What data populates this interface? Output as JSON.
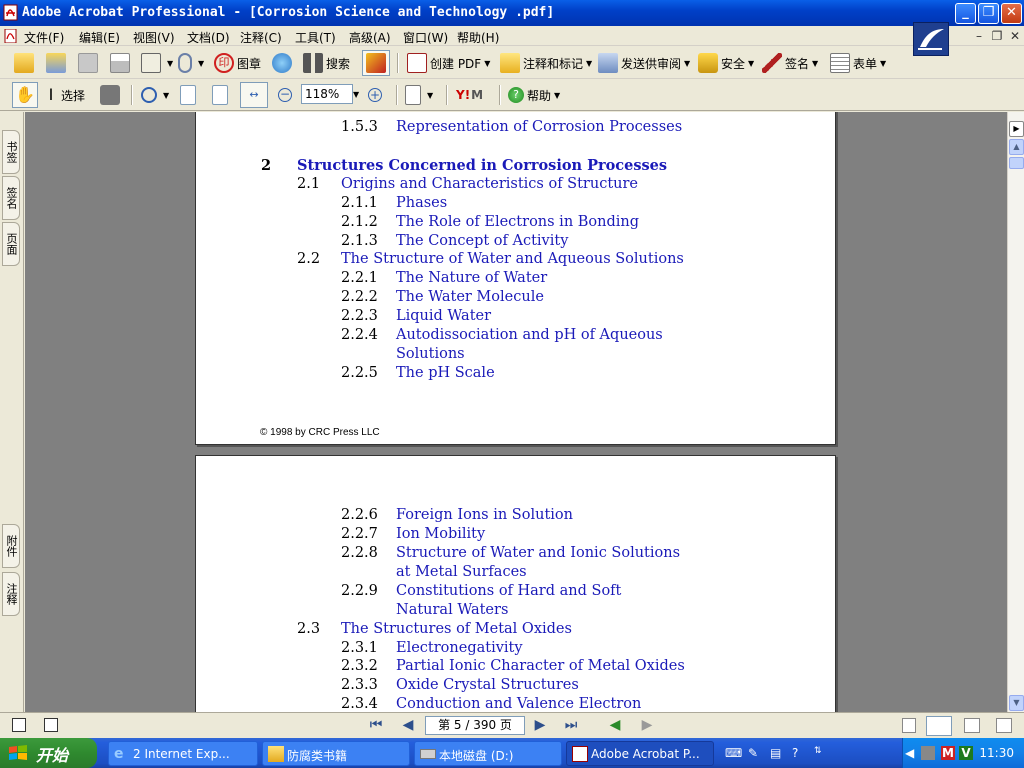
{
  "window": {
    "title": "Adobe Acrobat Professional - [Corrosion Science and Technology .pdf]"
  },
  "menu": [
    "文件(F)",
    "编辑(E)",
    "视图(V)",
    "文档(D)",
    "注释(C)",
    "工具(T)",
    "高级(A)",
    "窗口(W)",
    "帮助(H)"
  ],
  "toolbar1": {
    "stamp_label": "图章",
    "search_label": "搜索",
    "create_pdf_label": "创建 PDF",
    "comment_label": "注释和标记",
    "review_label": "发送供审阅",
    "security_label": "安全",
    "sign_label": "签名",
    "forms_label": "表单"
  },
  "toolbar2": {
    "select_label": "选择",
    "zoom_value": "118%",
    "help_label": "帮助"
  },
  "nav_tabs": {
    "bookmarks": "书签",
    "signatures": "签名",
    "pages": "页面",
    "attachments": "附件",
    "comments": "注释"
  },
  "page1": {
    "entries": [
      {
        "num": "1.5.3",
        "title": "Representation of Corrosion Processes"
      },
      {
        "num": "2",
        "title": "Structures Concerned in Corrosion Processes"
      },
      {
        "num": "2.1",
        "title": "Origins and Characteristics of Structure"
      },
      {
        "num": "2.1.1",
        "title": "Phases"
      },
      {
        "num": "2.1.2",
        "title": "The Role of Electrons in Bonding"
      },
      {
        "num": "2.1.3",
        "title": "The Concept of Activity"
      },
      {
        "num": "2.2",
        "title": "The Structure of Water and Aqueous Solutions"
      },
      {
        "num": "2.2.1",
        "title": "The Nature of Water"
      },
      {
        "num": "2.2.2",
        "title": "The Water Molecule"
      },
      {
        "num": "2.2.3",
        "title": "Liquid Water"
      },
      {
        "num": "2.2.4",
        "title": "Autodissociation and pH of Aqueous",
        "title2": "Solutions"
      },
      {
        "num": "2.2.5",
        "title": "The pH Scale"
      }
    ],
    "copyright": "© 1998 by CRC Press LLC"
  },
  "page2": {
    "entries": [
      {
        "num": "2.2.6",
        "title": "Foreign Ions in Solution"
      },
      {
        "num": "2.2.7",
        "title": "Ion Mobility"
      },
      {
        "num": "2.2.8",
        "title": "Structure of Water and Ionic Solutions",
        "title2": "at Metal Surfaces"
      },
      {
        "num": "2.2.9",
        "title": "Constitutions of Hard and Soft",
        "title2": "Natural Waters"
      },
      {
        "num": "2.3",
        "title": "The Structures of Metal Oxides"
      },
      {
        "num": "2.3.1",
        "title": "Electronegativity"
      },
      {
        "num": "2.3.2",
        "title": "Partial Ionic Character of Metal Oxides"
      },
      {
        "num": "2.3.3",
        "title": "Oxide Crystal Structures"
      },
      {
        "num": "2.3.4",
        "title": "Conduction and Valence Electron"
      }
    ]
  },
  "status": {
    "page_indicator": "第 5 / 390 页"
  },
  "taskbar": {
    "start_label": "开始",
    "items": [
      "2 Internet Exp...",
      "防腐类书籍",
      "本地磁盘 (D:)",
      "Adobe Acrobat P..."
    ],
    "clock": "11:30"
  },
  "colors": {
    "toc_link": "#1a1ab8",
    "titlebar": "#0A5FE8",
    "taskbar": "#245EDC"
  }
}
